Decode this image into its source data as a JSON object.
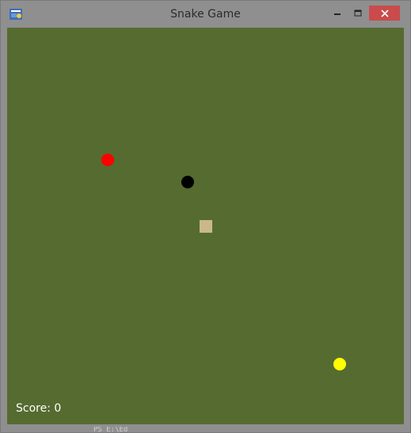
{
  "window": {
    "title": "Snake Game",
    "icon": "python-icon",
    "controls": {
      "minimize_icon": "minimize-icon",
      "maximize_icon": "maximize-icon",
      "close_icon": "close-icon",
      "close_color": "#c94b4b"
    }
  },
  "game": {
    "background_color": "#566b30",
    "score_text": "Score: 0",
    "objects": [
      {
        "name": "food-red",
        "color": "#ff0000"
      },
      {
        "name": "snake-head",
        "color": "#000000"
      },
      {
        "name": "snake-segment",
        "color": "#c9b88a"
      },
      {
        "name": "food-yellow",
        "color": "#ffff00"
      }
    ]
  },
  "background": {
    "console_hint": "PS E:\\Ed"
  }
}
